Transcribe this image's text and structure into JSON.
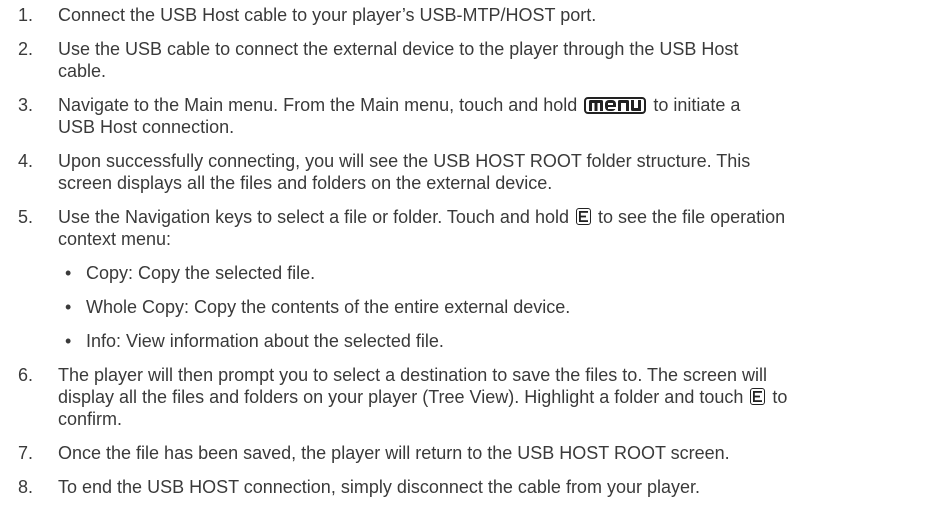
{
  "steps": [
    {
      "num": "1.",
      "t1": "Connect the USB Host cable to your player’s USB-MTP/HOST port."
    },
    {
      "num": "2.",
      "t1": "Use the USB cable to connect the external device to the player through the USB Host",
      "t2": "cable."
    },
    {
      "num": "3.",
      "t1": "Navigate to the Main menu. From the Main menu,  touch and hold",
      "t1b": "to initiate a",
      "t2": "USB Host connection."
    },
    {
      "num": "4.",
      "t1": "Upon successfully connecting, you will see the USB HOST ROOT folder structure. This",
      "t2": "screen displays all the files and folders on the external device."
    },
    {
      "num": "5.",
      "t1": "Use the Navigation keys to select a file or folder. Touch and hold",
      "t1b": "to see the file operation",
      "t2": "context menu:"
    },
    {
      "num": "6.",
      "t1": "The player will then prompt you to select a destination to save the files to. The screen will",
      "t2": "display all the files and folders on your player (Tree View). Highlight a folder and touch",
      "t3": "confirm.",
      "t2b": "to"
    },
    {
      "num": "7.",
      "t1": "Once the file has been saved, the player will return to the USB HOST ROOT screen."
    },
    {
      "num": "8.",
      "t1": "To end the USB HOST connection, simply disconnect the cable from your player."
    }
  ],
  "bullets": [
    {
      "dot": "•",
      "text": "Copy: Copy the selected file."
    },
    {
      "dot": "•",
      "text": "Whole Copy: Copy the contents of the entire external device."
    },
    {
      "dot": "•",
      "text": "Info: View information about the selected file."
    }
  ],
  "icons": {
    "menu_key": "menu-key-icon",
    "enter_key": "enter-key-icon"
  }
}
